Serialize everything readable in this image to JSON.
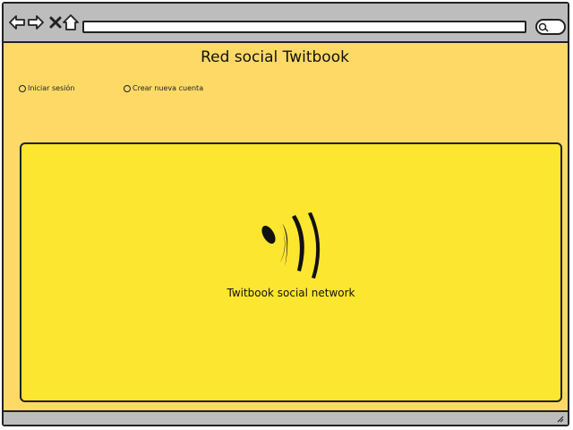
{
  "browser": {
    "url": "",
    "icons": [
      "back-arrow-icon",
      "forward-arrow-icon",
      "close-icon",
      "home-icon",
      "search-icon"
    ]
  },
  "page": {
    "title": "Red social Twitbook",
    "options": [
      {
        "label": "Iniciar sesión"
      },
      {
        "label": "Crear nueva cuenta"
      }
    ],
    "panel": {
      "caption": "Twitbook social network"
    }
  },
  "colors": {
    "page_background": "#ffd966",
    "panel_background": "#fde62f",
    "chrome": "#bdbdbd"
  }
}
